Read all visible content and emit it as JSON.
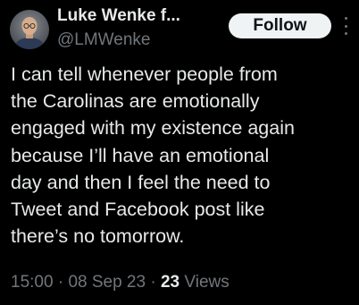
{
  "author": {
    "display_name": "Luke Wenke f...",
    "handle": "@LMWenke"
  },
  "follow_button": {
    "label": "Follow"
  },
  "tweet": {
    "lines": [
      "I can tell whenever people from",
      "the Carolinas are emotionally",
      "engaged with my existence again",
      "because I’ll have an emotional",
      "day and then I feel the need to",
      "Tweet and Facebook post like",
      "there’s no tomorrow."
    ]
  },
  "meta": {
    "time": "15:00",
    "separator_1": " · ",
    "date": "08 Sep 23",
    "separator_2": " · ",
    "views_count": "23",
    "views_label": " Views"
  },
  "icons": {
    "avatar": "avatar",
    "more": "more-icon"
  },
  "colors": {
    "background": "#000000",
    "text_primary": "#e7e9ea",
    "text_secondary": "#71767b",
    "follow_bg": "#eff3f4",
    "follow_text": "#0f1419"
  }
}
